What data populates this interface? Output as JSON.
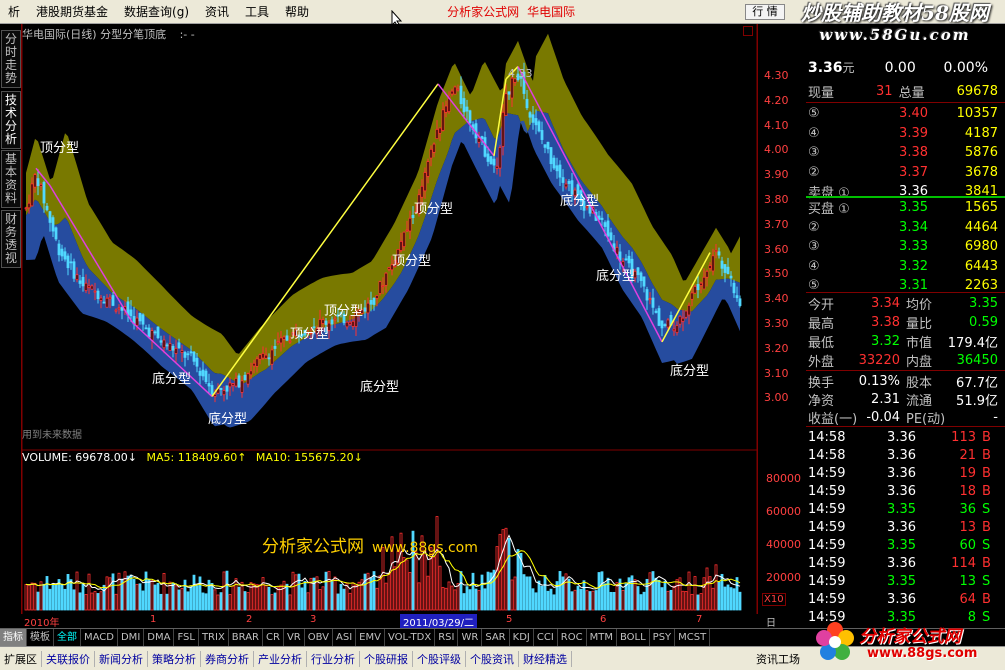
{
  "menu": {
    "items": [
      "析",
      "港股期货基金",
      "数据查询(g)",
      "资讯",
      "工具",
      "帮助"
    ],
    "window_title": "分析家公式网",
    "stock_name_title": "华电国际",
    "right_button": "行 情"
  },
  "watermark_top": {
    "line1": "炒股辅助教材58股网",
    "line2": "www.58Gu.com"
  },
  "sidebar": {
    "tabs": [
      "分时走势",
      "技术分析",
      "基本资料",
      "财务透视"
    ]
  },
  "chart": {
    "title": "华电国际(日线) 分型分笔顶底",
    "title_suffix": ":- -",
    "future_note": "用到未来数据",
    "price_axis": [
      "4.30",
      "4.20",
      "4.10",
      "4.00",
      "3.90",
      "3.80",
      "3.70",
      "3.60",
      "3.50",
      "3.40",
      "3.30",
      "3.20",
      "3.10",
      "3.00"
    ],
    "peak_label": "4.33",
    "annotations": [
      {
        "text": "顶分型"
      },
      {
        "text": "底分型"
      },
      {
        "text": "底分型"
      },
      {
        "text": "顶分型"
      },
      {
        "text": "顶分型"
      },
      {
        "text": "底分型"
      },
      {
        "text": "顶分型"
      },
      {
        "text": "顶分型"
      },
      {
        "text": "底分型"
      },
      {
        "text": "底分型"
      },
      {
        "text": "底分型"
      }
    ],
    "colors": {
      "up": "#ff3030",
      "down": "#50d8ff",
      "band_upper": "#808000",
      "band_lower": "#2850a8",
      "zigzag_up": "#ffff40",
      "zigzag_down": "#e040e0"
    }
  },
  "volume": {
    "label_volume": "VOLUME: 69678.00",
    "label_ma5": "MA5: 118409.60",
    "label_ma10": "MA10: 155675.20",
    "axis": [
      "80000",
      "60000",
      "40000",
      "20000"
    ],
    "unit": "X10",
    "watermark": "分析家公式网",
    "watermark_url": "www.88gs.com"
  },
  "date_axis": {
    "year": "2010年",
    "months": [
      "1",
      "2",
      "3",
      "5",
      "6",
      "7"
    ],
    "cursor_date": "2011/03/29/二",
    "period": "日线"
  },
  "quote": {
    "price": "3.36",
    "price_unit": "元",
    "change": "0.00",
    "pct": "0.00%",
    "current_hand_label": "现量",
    "current_hand": "31",
    "total_vol_label": "总量",
    "total_vol": "69678",
    "sells": [
      {
        "level": "⑤",
        "price": "3.40",
        "vol": "10357"
      },
      {
        "level": "④",
        "price": "3.39",
        "vol": "4187"
      },
      {
        "level": "③",
        "price": "3.38",
        "vol": "5876"
      },
      {
        "level": "②",
        "price": "3.37",
        "vol": "3678"
      },
      {
        "level": "卖盘 ①",
        "price": "3.36",
        "vol": "3841"
      }
    ],
    "buys": [
      {
        "level": "买盘 ①",
        "price": "3.35",
        "vol": "1565"
      },
      {
        "level": "②",
        "price": "3.34",
        "vol": "4464"
      },
      {
        "level": "③",
        "price": "3.33",
        "vol": "6980"
      },
      {
        "level": "④",
        "price": "3.32",
        "vol": "6443"
      },
      {
        "level": "⑤",
        "price": "3.31",
        "vol": "2263"
      }
    ],
    "stats": [
      {
        "l1": "今开",
        "v1": "3.34",
        "c1": "#ff3030",
        "l2": "均价",
        "v2": "3.35",
        "c2": "#00ff00"
      },
      {
        "l1": "最高",
        "v1": "3.38",
        "c1": "#ff3030",
        "l2": "量比",
        "v2": "0.59",
        "c2": "#00ff00"
      },
      {
        "l1": "最低",
        "v1": "3.32",
        "c1": "#00ff00",
        "l2": "市值",
        "v2": "179.4亿",
        "c2": "#ffffff"
      },
      {
        "l1": "外盘",
        "v1": "33220",
        "c1": "#ff3030",
        "l2": "内盘",
        "v2": "36450",
        "c2": "#00ff00"
      }
    ],
    "stats2": [
      {
        "l1": "换手",
        "v1": "0.13%",
        "l2": "股本",
        "v2": "67.7亿"
      },
      {
        "l1": "净资",
        "v1": "2.31",
        "l2": "流通",
        "v2": "51.9亿"
      },
      {
        "l1": "收益(一)",
        "v1": "-0.04",
        "l2": "PE(动)",
        "v2": "-"
      }
    ],
    "ticks": [
      {
        "time": "14:58",
        "price": "3.36",
        "pc": "#ffffff",
        "vol": "113",
        "side": "B"
      },
      {
        "time": "14:58",
        "price": "3.36",
        "pc": "#ffffff",
        "vol": "21",
        "side": "B"
      },
      {
        "time": "14:59",
        "price": "3.36",
        "pc": "#ffffff",
        "vol": "19",
        "side": "B"
      },
      {
        "time": "14:59",
        "price": "3.36",
        "pc": "#ffffff",
        "vol": "18",
        "side": "B"
      },
      {
        "time": "14:59",
        "price": "3.35",
        "pc": "#00ff00",
        "vol": "36",
        "side": "S"
      },
      {
        "time": "14:59",
        "price": "3.36",
        "pc": "#ffffff",
        "vol": "13",
        "side": "B"
      },
      {
        "time": "14:59",
        "price": "3.35",
        "pc": "#00ff00",
        "vol": "60",
        "side": "S"
      },
      {
        "time": "14:59",
        "price": "3.36",
        "pc": "#ffffff",
        "vol": "114",
        "side": "B"
      },
      {
        "time": "14:59",
        "price": "3.35",
        "pc": "#00ff00",
        "vol": "13",
        "side": "S"
      },
      {
        "time": "14:59",
        "price": "3.36",
        "pc": "#ffffff",
        "vol": "64",
        "side": "B"
      },
      {
        "time": "14:59",
        "price": "3.35",
        "pc": "#00ff00",
        "vol": "8",
        "side": "S"
      }
    ]
  },
  "indicator_tabs": [
    "指标",
    "模板",
    "全部",
    "MACD",
    "DMI",
    "DMA",
    "FSL",
    "TRIX",
    "BRAR",
    "CR",
    "VR",
    "OBV",
    "ASI",
    "EMV",
    "VOL-TDX",
    "RSI",
    "WR",
    "SAR",
    "KDJ",
    "CCI",
    "ROC",
    "MTM",
    "BOLL",
    "PSY",
    "MCST"
  ],
  "bottom_tabs": [
    "扩展区",
    "关联报价",
    "新闻分析",
    "策略分析",
    "券商分析",
    "产业分析",
    "行业分析",
    "个股研报",
    "个股评级",
    "个股资讯",
    "财经精选"
  ],
  "bottom_right": "资讯工场",
  "logo": {
    "text": "分析家公式网",
    "url": "www.88gs.com"
  }
}
